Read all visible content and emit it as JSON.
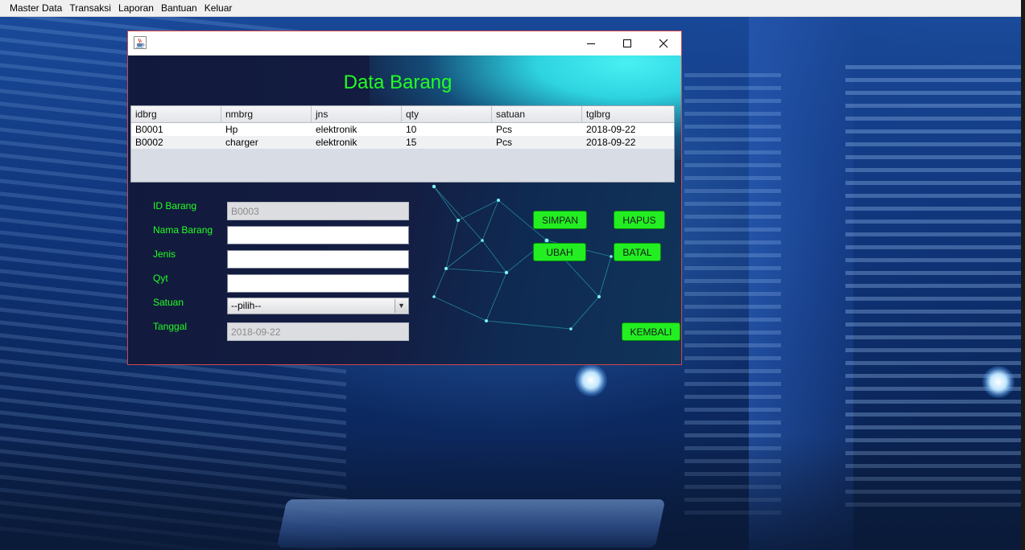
{
  "menubar": {
    "items": [
      "Master Data",
      "Transaksi",
      "Laporan",
      "Bantuan",
      "Keluar"
    ]
  },
  "window": {
    "icon": "java-cup-icon",
    "title": "Data Barang",
    "controls": [
      "minimize-icon",
      "maximize-icon",
      "close-icon"
    ]
  },
  "table": {
    "columns": [
      "idbrg",
      "nmbrg",
      "jns",
      "qty",
      "satuan",
      "tglbrg"
    ],
    "rows": [
      [
        "B0001",
        "Hp",
        "elektronik",
        "10",
        "Pcs",
        "2018-09-22"
      ],
      [
        "B0002",
        "charger",
        "elektronik",
        "15",
        "Pcs",
        "2018-09-22"
      ]
    ]
  },
  "form": {
    "id_label": "ID Barang",
    "id_value": "B0003",
    "nama_label": "Nama Barang",
    "nama_value": "",
    "jenis_label": "Jenis",
    "jenis_value": "",
    "qty_label": "Qyt",
    "qty_value": "",
    "satuan_label": "Satuan",
    "satuan_value": "--pilih--",
    "tanggal_label": "Tanggal",
    "tanggal_value": "2018-09-22"
  },
  "buttons": {
    "simpan": "SIMPAN",
    "hapus": "HAPUS",
    "ubah": "UBAH",
    "batal": "BATAL",
    "kembali": "KEMBALI"
  },
  "colors": {
    "label_green": "#22ff22",
    "button_green": "#22ee22",
    "frame_border": "#d04848"
  }
}
